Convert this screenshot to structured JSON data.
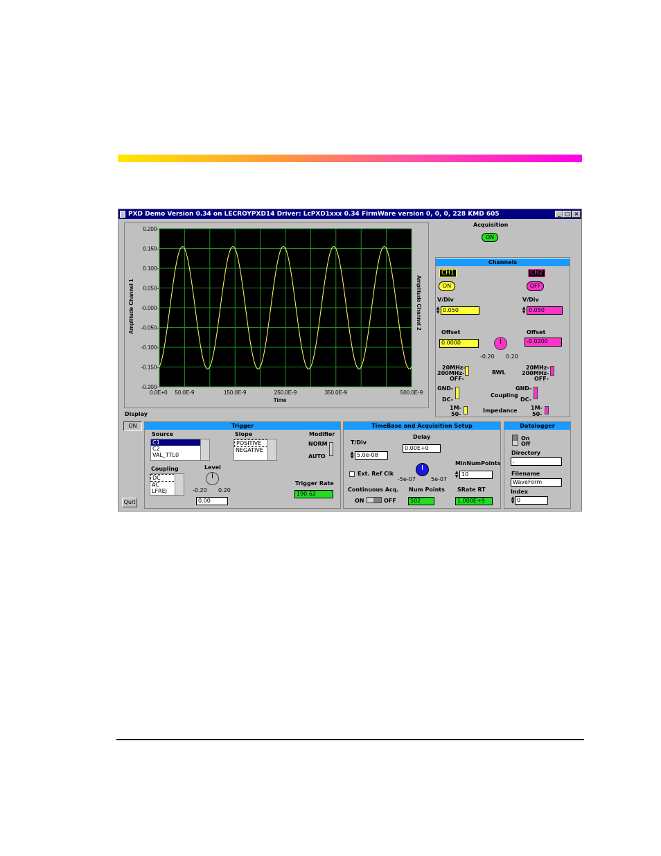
{
  "window": {
    "title": "PXD Demo Version 0.34 on LECROYPXD14   Driver: LcPXD1xxx 0.34 FirmWare version 0, 0, 0, 228 KMD 605",
    "controls": [
      "_",
      "□",
      "×"
    ]
  },
  "plot": {
    "ylabel_left": "Amplitude Channel 1",
    "ylabel_right": "Amplitude Channel 2",
    "xlabel": "Time",
    "yticks": [
      "0.200-",
      "0.150-",
      "0.100-",
      "0.050-",
      "-0.000-",
      "-0.050-",
      "-0.100-",
      "-0.150-",
      "-0.200-"
    ],
    "xticks": [
      "0.0E+0",
      "50.0E-9",
      "150.0E-9",
      "250.0E-9",
      "350.0E-9",
      "500.0E-9"
    ]
  },
  "chart_data": {
    "type": "line",
    "xlabel": "Time",
    "ylabel": "Amplitude Channel 1",
    "xlim": [
      0,
      5e-07
    ],
    "ylim": [
      -0.2,
      0.2
    ],
    "grid": true,
    "series": [
      {
        "color": "#ffff66",
        "amplitude": 0.155,
        "period": 1e-07,
        "phase_deg": -75
      }
    ]
  },
  "display": {
    "label": "Display",
    "button": "ON"
  },
  "quit": {
    "label": "Quit"
  },
  "acquisition": {
    "label": "Acquisition",
    "button": "ON"
  },
  "channels": {
    "title": "Channels",
    "ch1": {
      "name": "CH1",
      "state": "ON",
      "vdiv_label": "V/Div",
      "vdiv": "0.050",
      "offset_label": "Offset",
      "offset": "0.0000"
    },
    "ch2": {
      "name": "CH2",
      "state": "OFF",
      "vdiv_label": "V/Div",
      "vdiv": "0.050",
      "offset_label": "Offset",
      "offset": "-0.0200"
    },
    "knob_min": "-0.20",
    "knob_max": "0.20",
    "bwl_label": "BWL",
    "bwl_opts": [
      "20MHz-",
      "200MHz-",
      "OFF-"
    ],
    "coupling_label": "Coupling",
    "coupling_opts": [
      "GND-",
      "DC-"
    ],
    "impedance_label": "Impedance",
    "impedance_opts": [
      "1M-",
      "50-"
    ]
  },
  "trigger": {
    "title": "Trigger",
    "source_label": "Source",
    "sources": [
      "C1",
      "C2",
      "VAL_TTL0"
    ],
    "slope_label": "Slope",
    "slopes": [
      "POSITIVE",
      "NEGATIVE"
    ],
    "modifier_label": "Modifier",
    "modifier_opts": [
      "NORM",
      "AUTO"
    ],
    "coupling_label": "Coupling",
    "couplings": [
      "DC",
      "AC",
      "LFREJ"
    ],
    "level_label": "Level",
    "level_min": "-0.20",
    "level_max": "0.20",
    "level_value": "0.00",
    "rate_label": "Trigger Rate",
    "rate_value": "190.62"
  },
  "timebase": {
    "title": "TimeBase and Acquisition Setup",
    "tdiv_label": "T/Div",
    "tdiv": "5.0e-08",
    "delay_label": "Delay",
    "delay": "0.00E+0",
    "extref_label": "Ext. Ref Clk",
    "knob_min": "-5e-07",
    "knob_max": "5e-07",
    "minnum_label": "MinNumPoints",
    "minnum": "10",
    "cont_label": "Continuous Acq.",
    "cont_on": "ON",
    "cont_off": "OFF",
    "numpoints_label": "Num Points",
    "numpoints": "502",
    "srate_label": "SRate RT",
    "srate": "1.000E+9"
  },
  "datalogger": {
    "title": "Datalogger",
    "on": "On",
    "off": "Off",
    "directory_label": "Directory",
    "directory": ".",
    "filename_label": "Filename",
    "filename": "WaveForm",
    "index_label": "Index",
    "index": "0"
  }
}
